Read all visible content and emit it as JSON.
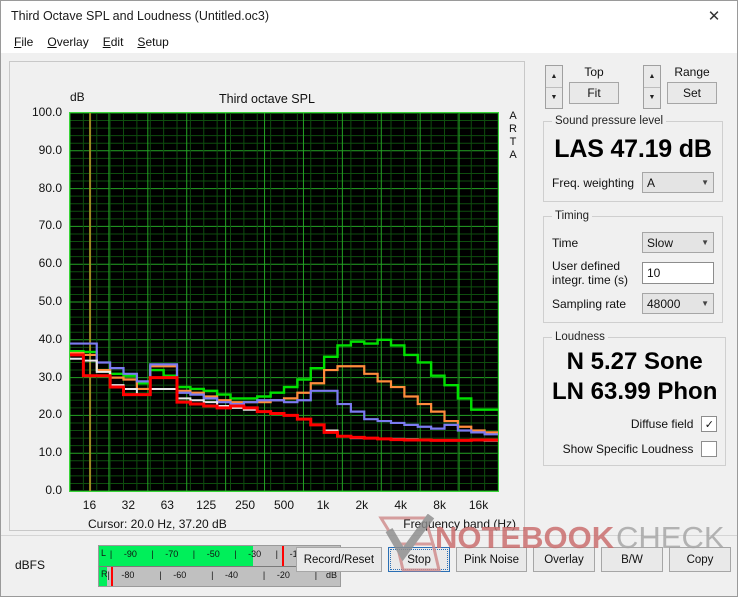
{
  "window": {
    "title": "Third Octave SPL and Loudness (Untitled.oc3)",
    "close_icon": "close-icon"
  },
  "menu": [
    {
      "pre": "F",
      "rest": "ile"
    },
    {
      "pre": "O",
      "rest": "verlay"
    },
    {
      "pre": "E",
      "rest": "dit"
    },
    {
      "pre": "S",
      "rest": "etup"
    }
  ],
  "chart_panel": {
    "title": "Third octave SPL",
    "unit_label": "dB",
    "brand": "ARTA",
    "cursor": "Cursor:   20.0 Hz, 37.20 dB",
    "axis_caption": "Frequency band (Hz)"
  },
  "controls": {
    "top_label": "Top",
    "fit_label": "Fit",
    "range_label": "Range",
    "set_label": "Set",
    "spinner_up": "▲",
    "spinner_down": "▼"
  },
  "spl": {
    "legend": "Sound pressure level",
    "reading": "LAS 47.19 dB",
    "weighting_label": "Freq. weighting",
    "weighting_value": "A"
  },
  "timing": {
    "legend": "Timing",
    "time_label": "Time",
    "time_value": "Slow",
    "integr_label_line1": "User defined",
    "integr_label_line2": "integr. time (s)",
    "integr_value": "10",
    "sampling_label": "Sampling rate",
    "sampling_value": "48000"
  },
  "loudness": {
    "legend": "Loudness",
    "sone": "N 5.27 Sone",
    "phon": "LN 63.99 Phon",
    "diffuse_label": "Diffuse field",
    "diffuse_checked": "✓",
    "specific_label": "Show Specific Loudness",
    "specific_checked": ""
  },
  "bottom": {
    "dbfs_label": "dBFS",
    "left_channel": "L",
    "right_channel": "R",
    "unit": "dB",
    "left_labels": [
      "-90",
      "-70",
      "-50",
      "-30",
      "-10"
    ],
    "right_labels": [
      "-80",
      "-60",
      "-40",
      "-20"
    ],
    "buttons": [
      {
        "label": "Record/Reset",
        "focused": false
      },
      {
        "label": "Stop",
        "focused": true
      },
      {
        "label": "Pink Noise",
        "focused": false
      },
      {
        "label": "Overlay",
        "focused": false
      },
      {
        "label": "B/W",
        "focused": false
      },
      {
        "label": "Copy",
        "focused": false
      }
    ]
  },
  "watermark": {
    "text_bold": "NOTEBOOK",
    "text_light": "CHECK"
  },
  "chart_data": {
    "type": "line",
    "title": "Third octave SPL",
    "xlabel": "Frequency band (Hz)",
    "ylabel": "dB",
    "ylim": [
      0.0,
      100.0
    ],
    "ytick_step": 10.0,
    "yticks": [
      0.0,
      10.0,
      20.0,
      30.0,
      40.0,
      50.0,
      60.0,
      70.0,
      80.0,
      90.0,
      100.0
    ],
    "grid": true,
    "plot_background": "#000000",
    "grid_color": "#1f8b1f",
    "step_style": "post",
    "xtick_labels": [
      "16",
      "32",
      "63",
      "125",
      "250",
      "500",
      "1k",
      "2k",
      "4k",
      "8k",
      "16k"
    ],
    "xtick_bands": [
      16,
      32,
      63,
      125,
      250,
      500,
      1000,
      2000,
      4000,
      8000,
      16000
    ],
    "categories": [
      16,
      20,
      25,
      31.5,
      40,
      50,
      63,
      80,
      100,
      125,
      160,
      200,
      250,
      315,
      400,
      500,
      630,
      800,
      1000,
      1250,
      1600,
      2000,
      2500,
      3150,
      4000,
      5000,
      6300,
      8000,
      10000,
      12500,
      16000,
      20000
    ],
    "series": [
      {
        "name": "green",
        "color": "#00e000",
        "width": 2.4,
        "values": [
          37.0,
          36.8,
          32.0,
          31.0,
          30.5,
          28.5,
          32.0,
          30.5,
          27.5,
          27.0,
          26.5,
          25.5,
          24.5,
          24.5,
          25.0,
          26.0,
          27.5,
          29.5,
          32.5,
          35.5,
          38.5,
          39.5,
          39.0,
          40.0,
          38.5,
          36.0,
          34.0,
          30.5,
          28.0,
          24.5,
          21.5,
          21.5
        ]
      },
      {
        "name": "orange",
        "color": "#ff8c3c",
        "width": 2.2,
        "values": [
          36.5,
          36.0,
          32.0,
          30.0,
          29.5,
          27.0,
          33.0,
          33.0,
          26.5,
          26.0,
          25.0,
          24.0,
          23.5,
          23.5,
          23.5,
          24.0,
          24.5,
          26.0,
          28.5,
          32.0,
          33.0,
          33.0,
          31.0,
          29.0,
          27.5,
          25.0,
          23.0,
          21.0,
          18.5,
          17.0,
          16.0,
          15.5
        ]
      },
      {
        "name": "violet",
        "color": "#7b7bf0",
        "width": 2.2,
        "values": [
          39.0,
          39.0,
          34.0,
          32.5,
          31.0,
          29.0,
          33.5,
          33.5,
          26.0,
          25.5,
          24.5,
          23.5,
          23.0,
          23.5,
          24.0,
          24.0,
          23.5,
          24.0,
          26.5,
          26.5,
          23.0,
          21.0,
          19.0,
          18.5,
          18.0,
          17.5,
          17.0,
          16.5,
          17.5,
          16.0,
          15.5,
          15.0
        ]
      },
      {
        "name": "white",
        "color": "#e8e8e8",
        "width": 2.0,
        "values": [
          35.0,
          34.5,
          31.5,
          28.0,
          27.0,
          25.5,
          27.0,
          27.0,
          24.5,
          24.0,
          23.5,
          22.5,
          22.0,
          21.5,
          21.0,
          20.5,
          20.0,
          19.0,
          17.5,
          16.0,
          14.5,
          14.0,
          14.0,
          13.8,
          13.8,
          13.7,
          13.6,
          13.5,
          13.5,
          13.4,
          13.4,
          13.3
        ]
      },
      {
        "name": "red",
        "color": "#ff0000",
        "width": 3.0,
        "values": [
          36.0,
          30.5,
          30.5,
          27.5,
          25.5,
          25.5,
          30.0,
          30.0,
          23.5,
          23.0,
          22.5,
          22.0,
          22.5,
          22.0,
          21.0,
          20.5,
          20.0,
          19.0,
          17.5,
          15.5,
          14.5,
          14.2,
          14.0,
          13.8,
          13.6,
          13.5,
          13.5,
          13.4,
          13.4,
          13.4,
          13.5,
          13.5
        ]
      }
    ]
  }
}
